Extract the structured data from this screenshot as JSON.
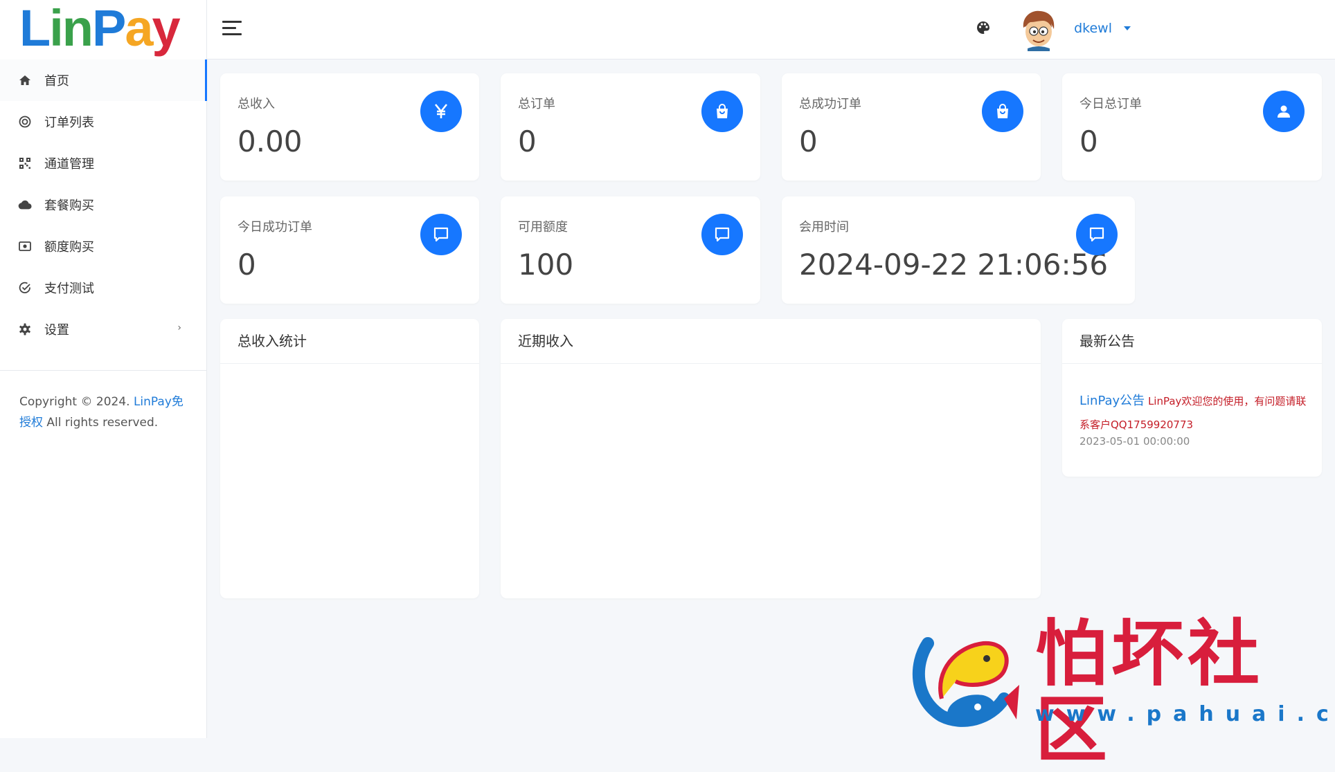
{
  "brand": {
    "logo_text": "LinPay"
  },
  "sidebar": {
    "items": [
      {
        "label": "首页",
        "icon": "home-icon",
        "active": true
      },
      {
        "label": "订单列表",
        "icon": "target-icon"
      },
      {
        "label": "通道管理",
        "icon": "qrcode-icon"
      },
      {
        "label": "套餐购买",
        "icon": "cloud-icon"
      },
      {
        "label": "额度购买",
        "icon": "money-icon"
      },
      {
        "label": "支付测试",
        "icon": "check-circle-icon"
      },
      {
        "label": "设置",
        "icon": "gear-icon",
        "has_submenu": true,
        "caret": "›"
      }
    ],
    "copyright": {
      "prefix": "Copyright © 2024. ",
      "link": "LinPay免授权",
      "suffix": " All rights reserved."
    }
  },
  "header": {
    "menu_icon": "hamburger-icon",
    "theme_icon": "palette-icon",
    "username": "dkewl"
  },
  "stats": [
    {
      "label": "总收入",
      "value": "0.00",
      "icon": "yen-icon"
    },
    {
      "label": "总订单",
      "value": "0",
      "icon": "shopping-bag-icon"
    },
    {
      "label": "总成功订单",
      "value": "0",
      "icon": "shopping-bag-icon"
    },
    {
      "label": "今日总订单",
      "value": "0",
      "icon": "user-icon"
    },
    {
      "label": "今日成功订单",
      "value": "0",
      "icon": "message-icon"
    },
    {
      "label": "可用额度",
      "value": "100",
      "icon": "message-icon"
    },
    {
      "label": "会用时间",
      "value": "2024-09-22 21:06:56",
      "icon": "message-icon"
    }
  ],
  "panels": {
    "income_stats": {
      "title": "总收入统计"
    },
    "recent_income": {
      "title": "近期收入"
    },
    "announcements": {
      "title": "最新公告",
      "item": {
        "title": "LinPay公告",
        "text": "LinPay欢迎您的使用，有问题请联系客户QQ1759920773",
        "date": "2023-05-01 00:00:00"
      }
    }
  },
  "watermark": {
    "name": "怕坏社区",
    "url": "www.pahuai.com"
  },
  "colors": {
    "accent": "#1677ff",
    "link": "#1f7bd8",
    "notice": "#c41d27",
    "background": "#f5f7fa"
  }
}
